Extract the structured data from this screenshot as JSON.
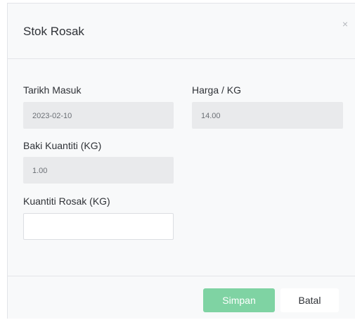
{
  "modal": {
    "title": "Stok Rosak",
    "close_glyph": "×"
  },
  "form": {
    "tarikh_masuk": {
      "label": "Tarikh Masuk",
      "value": "2023-02-10"
    },
    "harga_kg": {
      "label": "Harga / KG",
      "value": "14.00"
    },
    "baki_kuantiti": {
      "label": "Baki Kuantiti (KG)",
      "value": "1.00"
    },
    "kuantiti_rosak": {
      "label": "Kuantiti Rosak (KG)",
      "value": ""
    }
  },
  "footer": {
    "save_label": "Simpan",
    "cancel_label": "Batal"
  },
  "colors": {
    "save_button": "#7fd3a3",
    "readonly_field": "#e9eaec",
    "modal_background": "#f8f9fa"
  }
}
